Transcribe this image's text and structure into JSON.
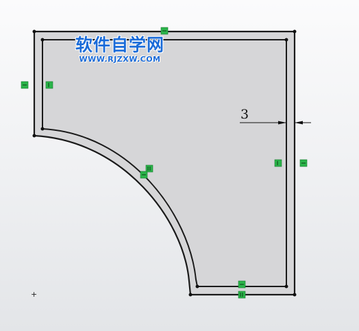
{
  "watermark": {
    "title": "软件自学网",
    "url": "WWW.RJZXW.COM"
  },
  "dimension": {
    "value": "3"
  },
  "origin_marker": {
    "glyph": "+"
  },
  "colors": {
    "background_top": "#fbfbfc",
    "background_bottom": "#e3e5e8",
    "sketch_fill": "#d6d6d8",
    "sketch_line": "#1a1a1a",
    "relation_marker": "#2bb44a",
    "watermark": "#1a6bd8"
  },
  "relation_markers": [
    {
      "name": "relation-marker-top",
      "kind": "horizontal"
    },
    {
      "name": "relation-marker-left-outer",
      "kind": "vertical"
    },
    {
      "name": "relation-marker-left-inner",
      "kind": "vertical"
    },
    {
      "name": "relation-marker-arc-1",
      "kind": "tangent"
    },
    {
      "name": "relation-marker-arc-2",
      "kind": "tangent"
    },
    {
      "name": "relation-marker-right-inner",
      "kind": "vertical"
    },
    {
      "name": "relation-marker-right-outer",
      "kind": "vertical"
    },
    {
      "name": "relation-marker-bottom-1",
      "kind": "horizontal"
    },
    {
      "name": "relation-marker-bottom-2",
      "kind": "horizontal"
    }
  ]
}
